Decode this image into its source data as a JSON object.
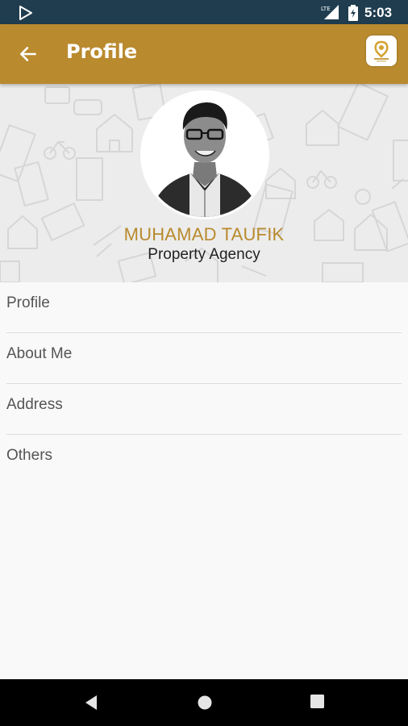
{
  "status_bar": {
    "time": "5:03",
    "network": "LTE"
  },
  "app_bar": {
    "title": "Profile"
  },
  "profile": {
    "name": "MUHAMAD TAUFIK",
    "subtitle": "Property Agency"
  },
  "menu": {
    "items": [
      {
        "label": "Profile"
      },
      {
        "label": "About Me"
      },
      {
        "label": "Address"
      },
      {
        "label": "Others"
      }
    ]
  },
  "colors": {
    "accent": "#b98a2e",
    "status_bar": "#1f3d4f"
  }
}
